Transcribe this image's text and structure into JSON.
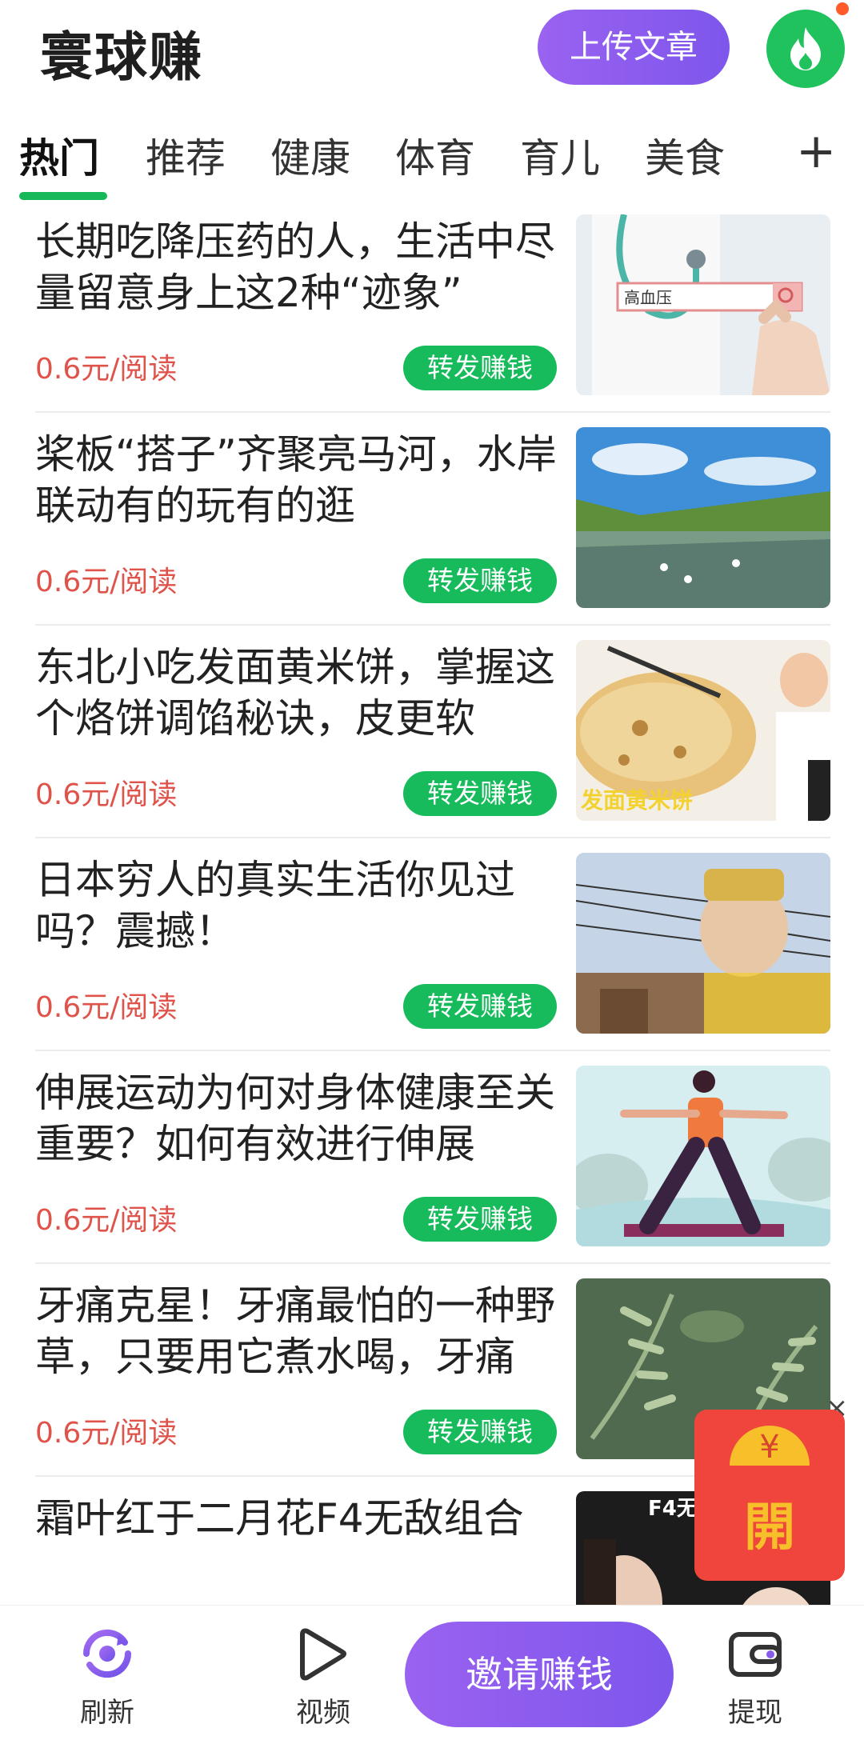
{
  "header": {
    "app_title": "寰球赚",
    "upload_label": "上传文章",
    "accent_green": "#1fc25c",
    "accent_purple": "#8a5cee"
  },
  "tabs": [
    {
      "label": "热门",
      "active": true
    },
    {
      "label": "推荐",
      "active": false
    },
    {
      "label": "健康",
      "active": false
    },
    {
      "label": "体育",
      "active": false
    },
    {
      "label": "育儿",
      "active": false
    },
    {
      "label": "美食",
      "active": false
    }
  ],
  "tab_add_icon": "+",
  "feed": [
    {
      "title": "长期吃降压药的人，生活中尽量留意身上这2种“迹象”",
      "price": "0.6元/阅读",
      "share_label": "转发赚钱",
      "thumb_text": "高血压"
    },
    {
      "title": "桨板“搭子”齐聚亮马河，水岸联动有的玩有的逛",
      "price": "0.6元/阅读",
      "share_label": "转发赚钱"
    },
    {
      "title": "东北小吃发面黄米饼，掌握这个烙饼调馅秘诀，皮更软",
      "price": "0.6元/阅读",
      "share_label": "转发赚钱",
      "thumb_text": "发面黄米饼"
    },
    {
      "title": "日本穷人的真实生活你见过吗？震撼！",
      "price": "0.6元/阅读",
      "share_label": "转发赚钱"
    },
    {
      "title": "伸展运动为何对身体健康至关重要？如何有效进行伸展",
      "price": "0.6元/阅读",
      "share_label": "转发赚钱"
    },
    {
      "title": "牙痛克星！牙痛最怕的一种野草，只要用它煮水喝，牙痛",
      "price": "0.6元/阅读",
      "share_label": "转发赚钱"
    },
    {
      "title": "霜叶红于二月花F4无敌组合",
      "price": "",
      "share_label": "",
      "thumb_text": "F4无"
    }
  ],
  "red_packet": {
    "coin_symbol": "¥",
    "open_label": "開",
    "close_symbol": "×"
  },
  "bottom_nav": {
    "refresh_label": "刷新",
    "video_label": "视频",
    "invite_label": "邀请赚钱",
    "withdraw_label": "提现"
  }
}
